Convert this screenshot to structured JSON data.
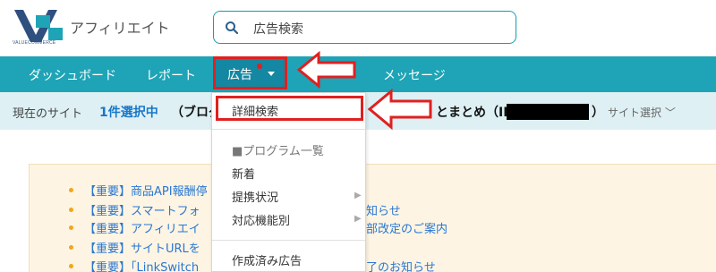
{
  "header": {
    "brand": "アフィリエイト",
    "logo_subtext": "VALUECOMMERCE",
    "search_text": "広告検索"
  },
  "nav": {
    "dashboard": "ダッシュボード",
    "report": "レポート",
    "ad": "広告",
    "messages": "メッセージ"
  },
  "sitebar": {
    "label": "現在のサイト",
    "selected": "1件選択中",
    "name_part1": "（ブログ",
    "name_part2": "とまとめ（ID:",
    "name_close": "）",
    "site_select": "サイト選択 ﹀"
  },
  "notices": [
    {
      "prefix": "【重要】商品API報酬停",
      "suffix": ""
    },
    {
      "prefix": "【重要】スマートフォ",
      "suffix": "知らせ"
    },
    {
      "prefix": "【重要】アフィリエイ",
      "suffix": "部改定のご案内"
    },
    {
      "prefix": "【重要】サイトURLを",
      "suffix": ""
    },
    {
      "prefix": "【重要】「LinkSwitch",
      "suffix": "了のお知らせ"
    }
  ],
  "dropdown": {
    "detail_search": "詳細検索",
    "program_list": "■プログラム一覧",
    "new": "新着",
    "partnership": "提携状況",
    "features": "対応機能別",
    "created_ads": "作成済み広告"
  },
  "colors": {
    "nav_bg": "#1ea4b6",
    "nav_active": "#1487a2",
    "highlight_red": "#e02020",
    "link_blue": "#2877d3",
    "sitebar_bg": "#def0f4",
    "notice_bg": "#fdf4e3"
  }
}
